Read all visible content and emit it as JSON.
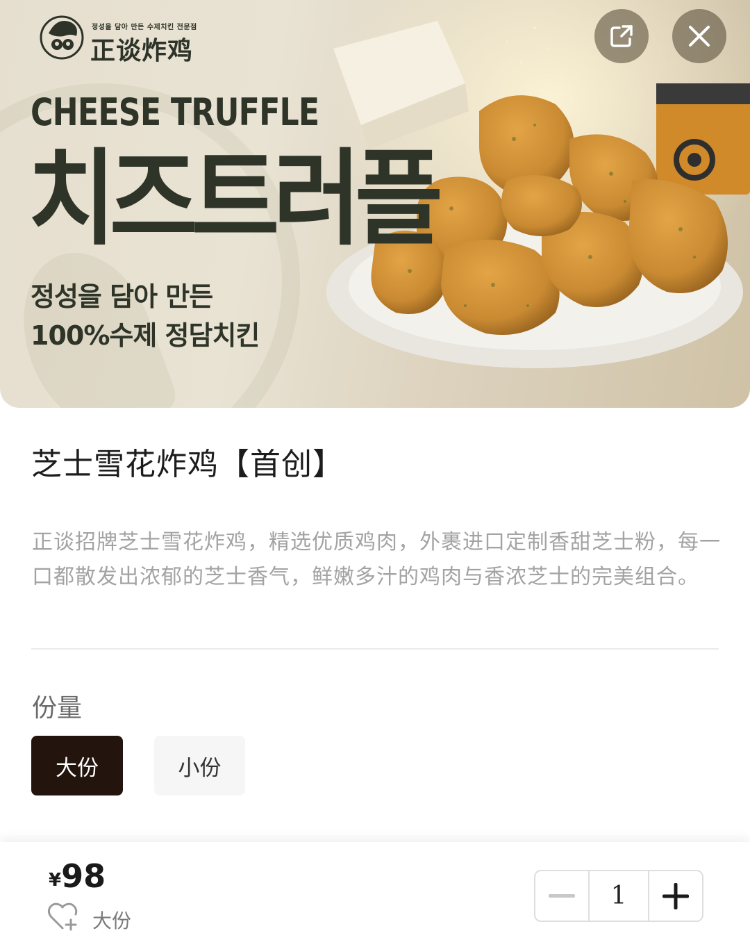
{
  "hero": {
    "brand_tagline": "정성을 담아 만든 수제치킨 전문점",
    "brand_name": "正谈炸鸡",
    "headline_en": "CHEESE TRUFFLE",
    "headline_ko": "치즈트러플",
    "sub_line1": "정성을 담아 만든",
    "sub_line2": "100%수제 정담치킨",
    "share_icon": "share-icon",
    "close_icon": "close-icon"
  },
  "product": {
    "title": "芝士雪花炸鸡【首创】",
    "description": "正谈招牌芝士雪花炸鸡，精选优质鸡肉，外裹进口定制香甜芝士粉，每一口都散发出浓郁的芝士香气，鲜嫩多汁的鸡肉与香浓芝士的完美组合。"
  },
  "spec": {
    "label": "份量",
    "options": [
      {
        "label": "大份",
        "selected": true
      },
      {
        "label": "小份",
        "selected": false
      }
    ]
  },
  "footer": {
    "currency": "¥",
    "price": "98",
    "selected_spec": "大份",
    "quantity": "1",
    "favorite_icon": "heart-plus-icon"
  },
  "colors": {
    "primary_dark": "#24140e",
    "muted_text": "#a3a3a3",
    "hero_text": "#2e3528"
  }
}
